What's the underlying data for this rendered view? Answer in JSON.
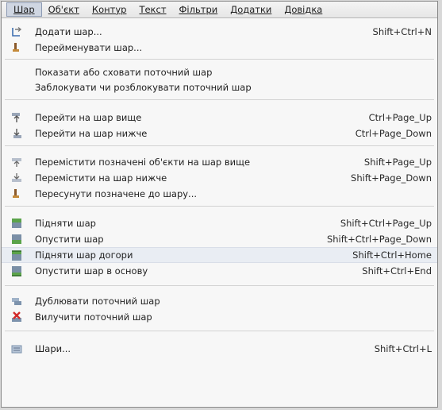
{
  "menubar": [
    "Шар",
    "Об'єкт",
    "Контур",
    "Текст",
    "Фільтри",
    "Додатки",
    "Довідка"
  ],
  "menu": {
    "add_layer": {
      "label": "Додати шар...",
      "shortcut": "Shift+Ctrl+N",
      "icon": "add-layer-icon"
    },
    "rename_layer": {
      "label": "Перейменувати шар...",
      "shortcut": "",
      "icon": "rename-layer-icon"
    },
    "toggle_visibility": {
      "label": "Показати або сховати поточний шар",
      "shortcut": ""
    },
    "toggle_lock": {
      "label": "Заблокувати чи розблокувати поточний шар",
      "shortcut": ""
    },
    "layer_up": {
      "label": "Перейти на шар вище",
      "shortcut": "Ctrl+Page_Up",
      "icon": "go-layer-above-icon"
    },
    "layer_down": {
      "label": "Перейти на шар нижче",
      "shortcut": "Ctrl+Page_Down",
      "icon": "go-layer-below-icon"
    },
    "move_sel_up": {
      "label": "Перемістити позначені об'єкти на шар вище",
      "shortcut": "Shift+Page_Up",
      "icon": "move-selection-above-icon"
    },
    "move_sel_down": {
      "label": "Перемістити на шар нижче",
      "shortcut": "Shift+Page_Down",
      "icon": "move-selection-below-icon"
    },
    "move_sel_to": {
      "label": "Пересунути позначене до шару...",
      "shortcut": "",
      "icon": "move-selection-to-layer-icon"
    },
    "raise": {
      "label": "Підняти шар",
      "shortcut": "Shift+Ctrl+Page_Up",
      "icon": "raise-layer-icon"
    },
    "lower": {
      "label": "Опустити шар",
      "shortcut": "Shift+Ctrl+Page_Down",
      "icon": "lower-layer-icon"
    },
    "raise_top": {
      "label": "Підняти шар догори",
      "shortcut": "Shift+Ctrl+Home",
      "icon": "raise-layer-to-top-icon"
    },
    "lower_bottom": {
      "label": "Опустити шар в основу",
      "shortcut": "Shift+Ctrl+End",
      "icon": "lower-layer-to-bottom-icon"
    },
    "duplicate": {
      "label": "Дублювати поточний шар",
      "shortcut": "",
      "icon": "duplicate-layer-icon"
    },
    "delete": {
      "label": "Вилучити поточний шар",
      "shortcut": "",
      "icon": "delete-layer-icon"
    },
    "layers": {
      "label": "Шари...",
      "shortcut": "Shift+Ctrl+L",
      "icon": "layers-dialog-icon"
    }
  },
  "colors": {
    "highlight": "#e9edf3",
    "accent": "#3e6fb0",
    "delete": "#d22a2a"
  }
}
